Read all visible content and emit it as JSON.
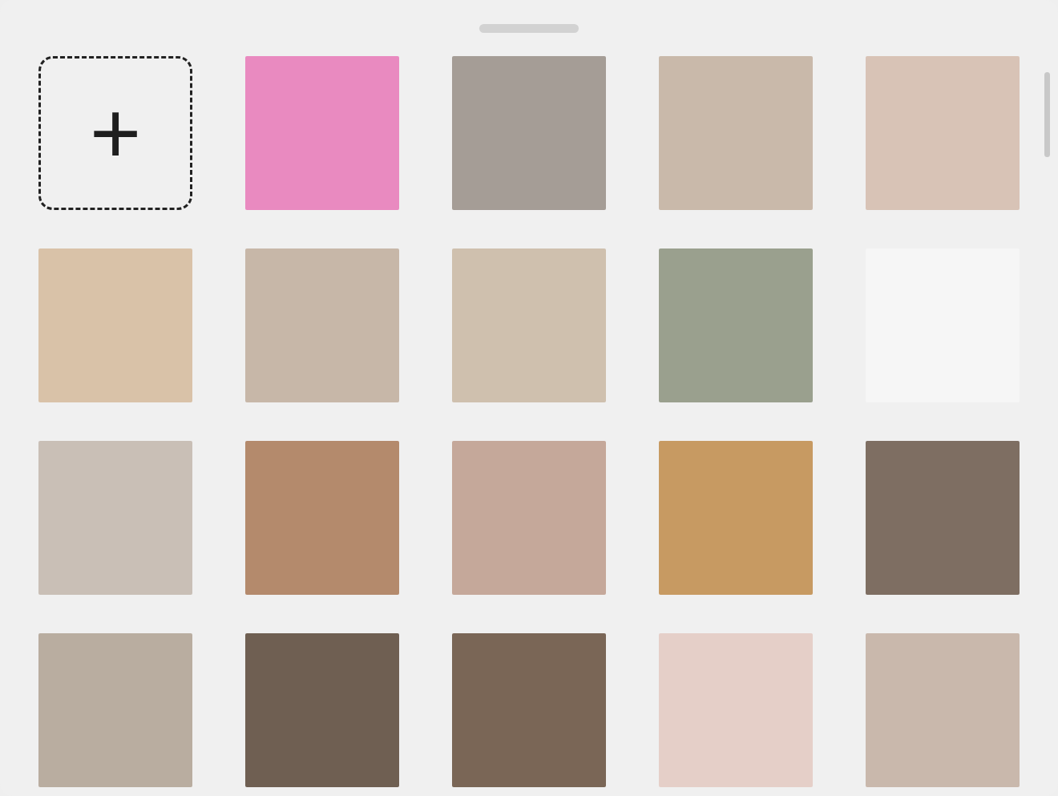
{
  "grid": {
    "items": [
      {
        "kind": "add",
        "label": "+"
      },
      {
        "kind": "photo"
      },
      {
        "kind": "photo"
      },
      {
        "kind": "photo"
      },
      {
        "kind": "photo"
      },
      {
        "kind": "photo"
      },
      {
        "kind": "photo"
      },
      {
        "kind": "photo"
      },
      {
        "kind": "photo"
      },
      {
        "kind": "photo"
      },
      {
        "kind": "photo"
      },
      {
        "kind": "photo"
      },
      {
        "kind": "photo"
      },
      {
        "kind": "photo"
      },
      {
        "kind": "photo"
      },
      {
        "kind": "photo"
      },
      {
        "kind": "photo"
      },
      {
        "kind": "photo"
      },
      {
        "kind": "photo"
      },
      {
        "kind": "photo"
      }
    ]
  }
}
